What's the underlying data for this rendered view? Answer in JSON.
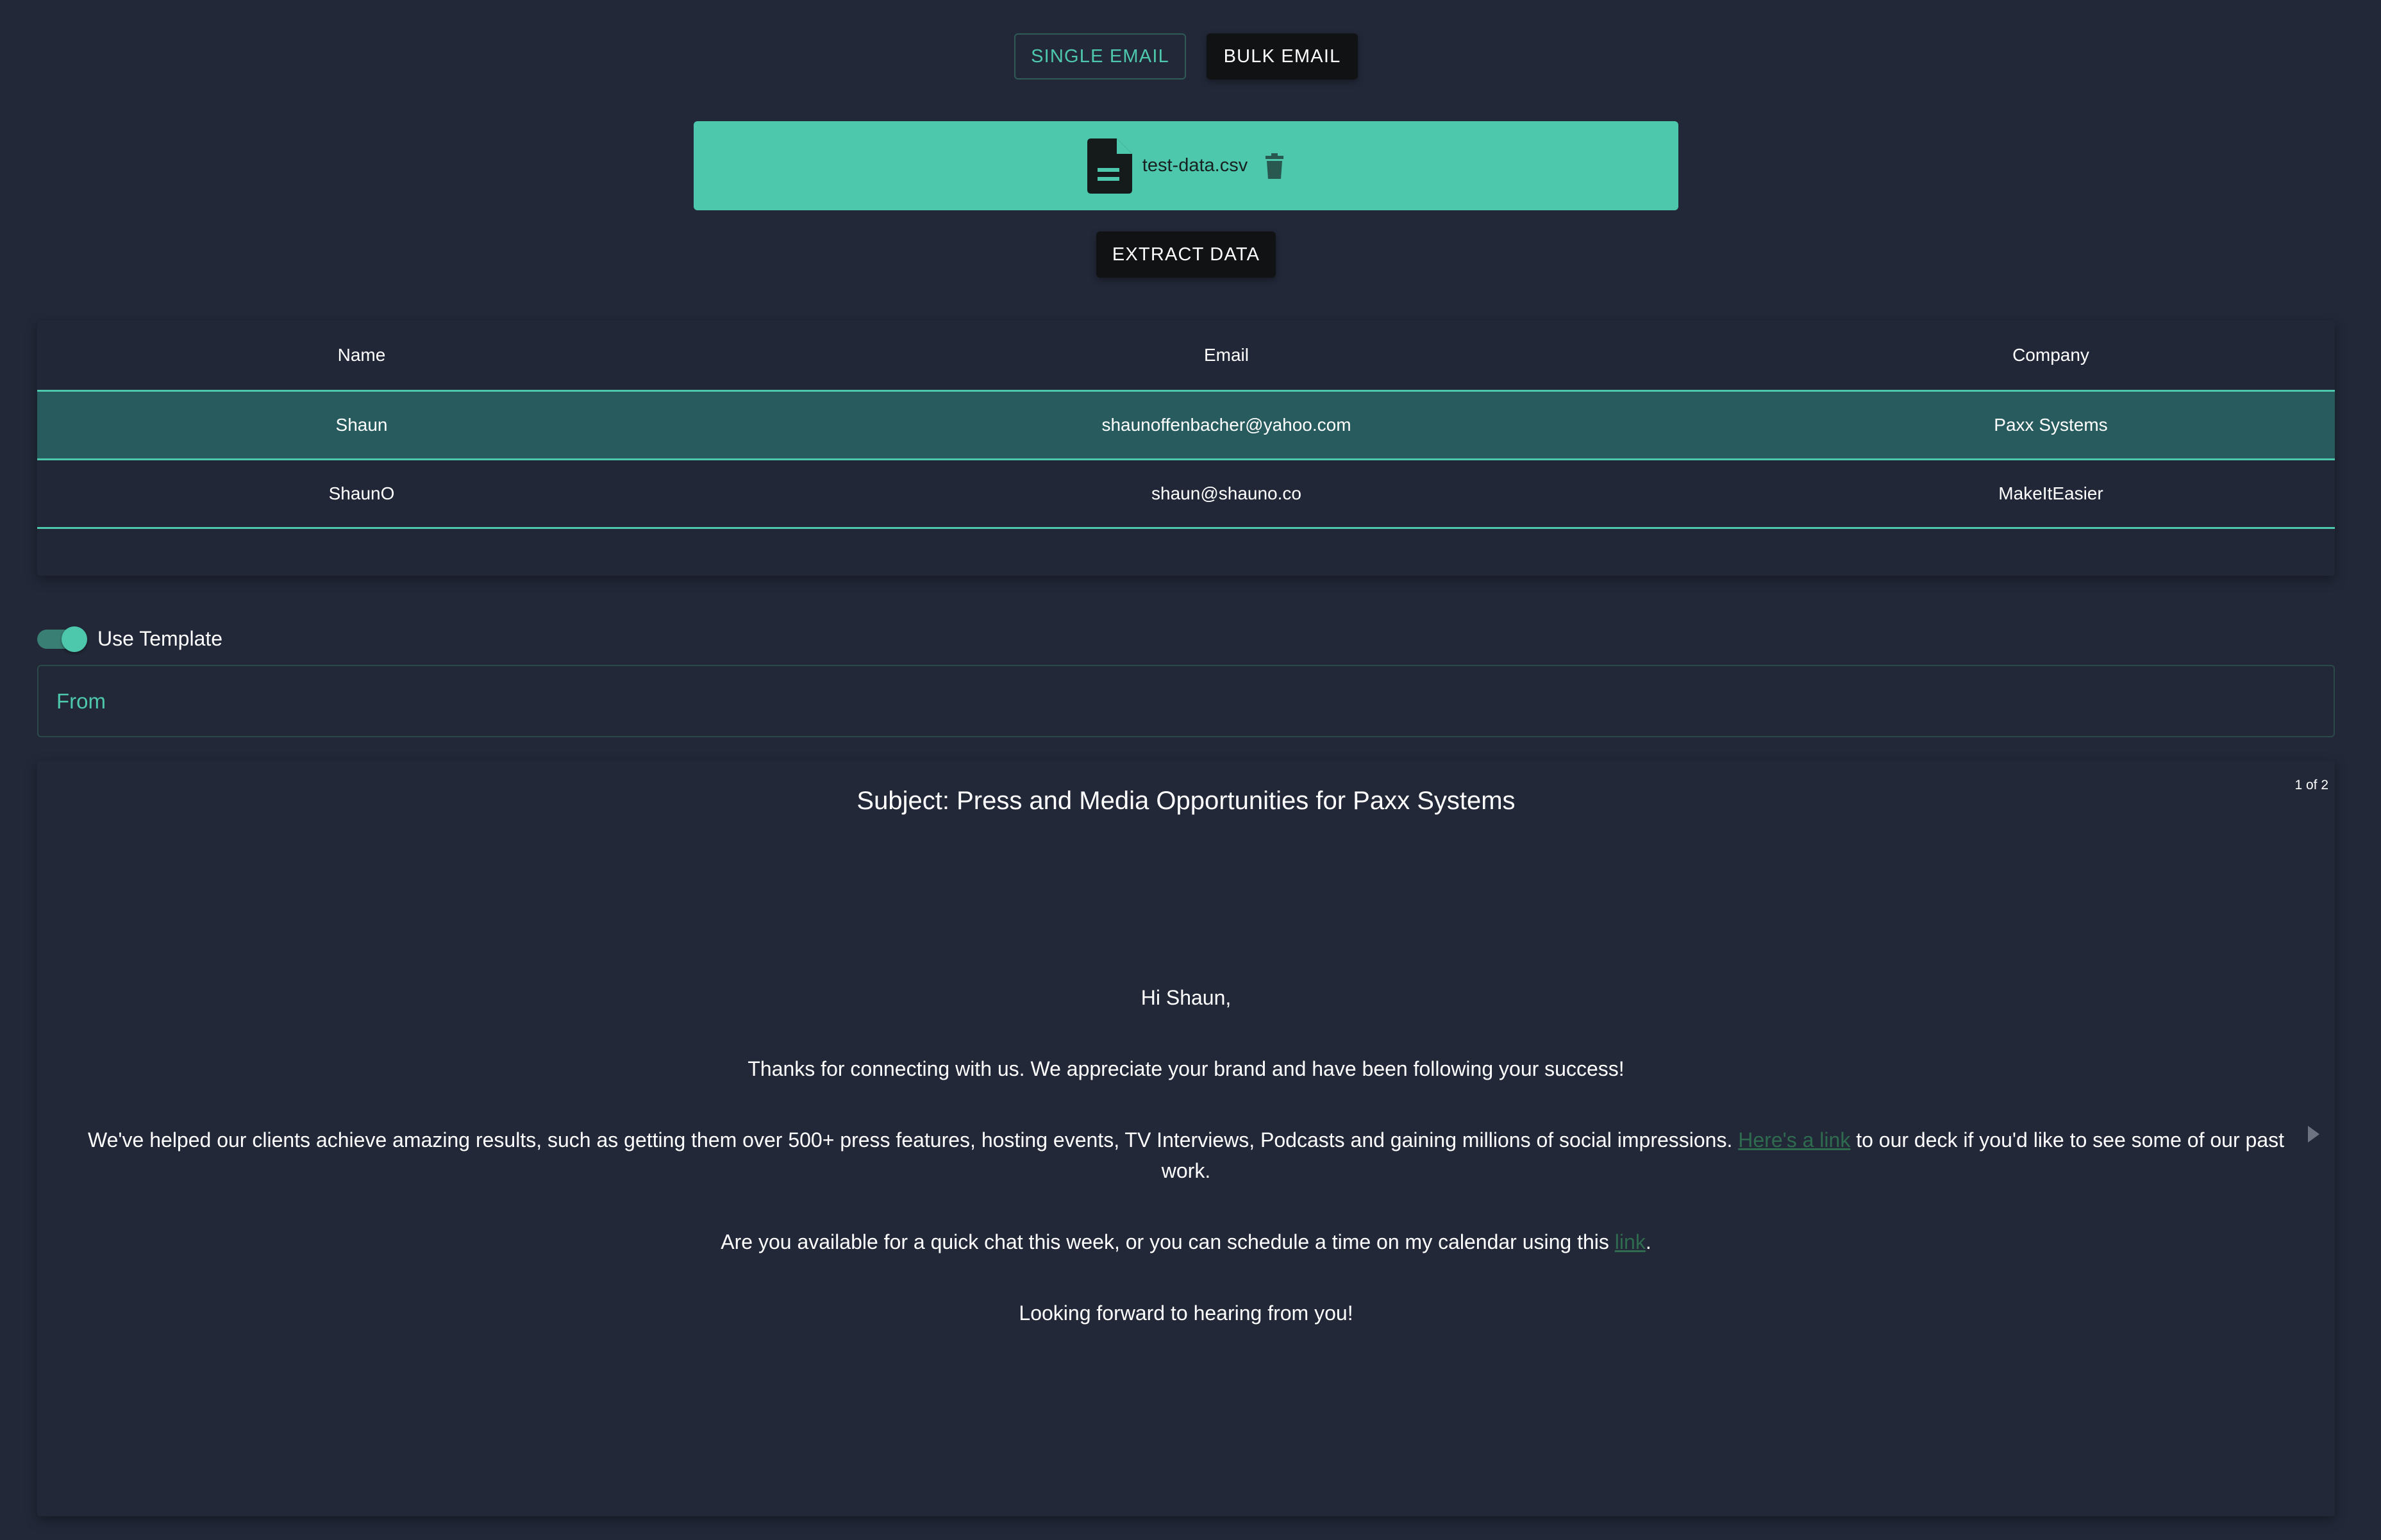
{
  "mode": {
    "single_label": "SINGLE EMAIL",
    "bulk_label": "BULK EMAIL"
  },
  "upload": {
    "file_name": "test-data.csv",
    "file_icon": "file-document-icon",
    "delete_icon": "trash-icon"
  },
  "extract_label": "EXTRACT DATA",
  "table": {
    "headers": [
      "Name",
      "Email",
      "Company"
    ],
    "rows": [
      [
        "Shaun",
        "shaunoffenbacher@yahoo.com",
        "Paxx Systems"
      ],
      [
        "ShaunO",
        "shaun@shauno.co",
        "MakeItEasier"
      ]
    ],
    "selected_row": 0
  },
  "template": {
    "label": "Use Template",
    "enabled": true
  },
  "from_field": {
    "placeholder": "From",
    "value": ""
  },
  "preview": {
    "counter": "1 of 2",
    "subject": "Subject: Press and Media Opportunities for Paxx Systems",
    "greeting": "Hi Shaun,",
    "p1": "Thanks for connecting with us. We appreciate your brand and have been following your success!",
    "p2_before": "We've helped our clients achieve amazing results, such as getting them over 500+ press features, hosting events, TV Interviews, Podcasts and gaining millions of social impressions. ",
    "p2_link": "Here's a link",
    "p2_after": " to our deck if you'd like to see some of our past work.",
    "p3_before": "Are you available for a quick chat this week, or you can schedule a time on my calendar using this ",
    "p3_link": "link",
    "p3_after": ".",
    "closing": "Looking forward to hearing from you!",
    "next_icon": "chevron-right-icon"
  },
  "colors": {
    "background": "#222838",
    "accent": "#4ec8ad",
    "selected_row": "#285b5e",
    "dark_button": "#111214"
  }
}
